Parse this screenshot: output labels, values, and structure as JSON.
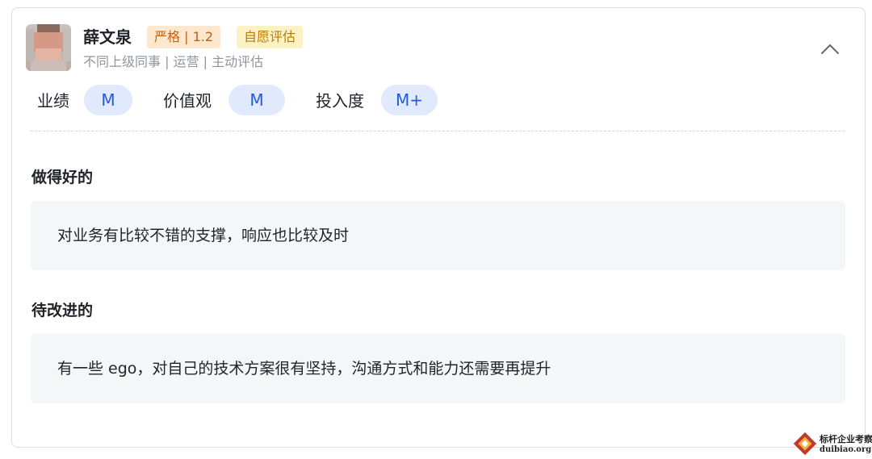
{
  "reviewer": {
    "name": "薛文泉",
    "tag_strict": "严格 | 1.2",
    "tag_voluntary": "自愿评估",
    "relation": "不同上级同事 | 运营 | 主动评估"
  },
  "ratings": [
    {
      "label": "业绩",
      "value": "M"
    },
    {
      "label": "价值观",
      "value": "M"
    },
    {
      "label": "投入度",
      "value": "M+"
    }
  ],
  "sections": {
    "good": {
      "title": "做得好的",
      "text": "对业务有比较不错的支撑，响应也比较及时"
    },
    "improve": {
      "title": "待改进的",
      "text": "有一些 ego，对自己的技术方案很有坚持，沟通方式和能力还需要再提升"
    }
  },
  "icons": {
    "collapse": "chevron-up-icon"
  },
  "colors": {
    "pill_bg": "#e1e9fd",
    "pill_text": "#245bdb",
    "tag_strict_bg": "#fde7cf",
    "tag_strict_text": "#c5610f",
    "tag_voluntary_bg": "#fdf1c6",
    "tag_voluntary_text": "#b77b05"
  },
  "watermark": {
    "line1": "标杆企业考察",
    "line2": "duibiao.org"
  }
}
